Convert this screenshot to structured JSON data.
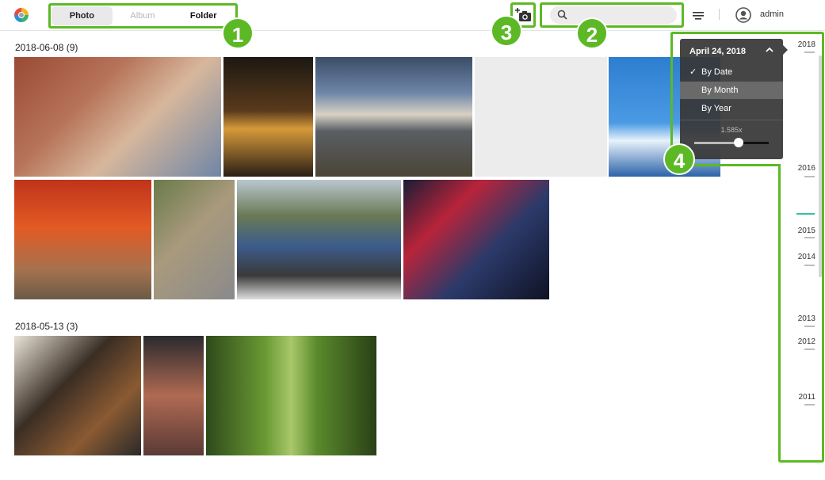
{
  "header": {
    "tabs": [
      {
        "label": "Photo",
        "state": "active"
      },
      {
        "label": "Album",
        "state": "disabled"
      },
      {
        "label": "Folder",
        "state": "normal"
      }
    ],
    "search": {
      "placeholder": "",
      "value": ""
    },
    "user": "admin",
    "icons": {
      "logo": "app-logo-icon",
      "upload": "camera-add-icon",
      "search": "search-icon",
      "filter": "filter-icon",
      "avatar": "user-avatar-icon"
    }
  },
  "sections": [
    {
      "title": "2018-06-08 (9)",
      "photos": [
        {
          "name": "two-women-laughing",
          "color": "#b58a6a"
        },
        {
          "name": "night-alley-signs",
          "color": "#3a2a1e"
        },
        {
          "name": "mount-fuji-clouds",
          "color": "#6f8198"
        },
        {
          "name": "placeholder-loading",
          "color": "#ececec"
        },
        {
          "name": "fuji-cherry-blossom",
          "color": "#3d8fd6"
        },
        {
          "name": "torii-gates",
          "color": "#d9521f"
        },
        {
          "name": "woman-curly-hair",
          "color": "#8c8a70"
        },
        {
          "name": "blue-car-street",
          "color": "#4e5a66"
        },
        {
          "name": "neon-street-night",
          "color": "#2a2f4a"
        }
      ]
    },
    {
      "title": "2018-05-13 (3)",
      "photos": [
        {
          "name": "food-table-teapot",
          "color": "#5a4a3a"
        },
        {
          "name": "woman-beanie",
          "color": "#7a4a3a"
        },
        {
          "name": "bamboo-forest",
          "color": "#4f7a2a"
        }
      ]
    }
  ],
  "timeline": {
    "years": [
      "2018",
      "2016",
      "2015",
      "2014",
      "2013",
      "2012",
      "2011"
    ]
  },
  "popover": {
    "date": "April 24, 2018",
    "options": [
      {
        "label": "By Date",
        "checked": true,
        "highlighted": false
      },
      {
        "label": "By Month",
        "checked": false,
        "highlighted": true
      },
      {
        "label": "By Year",
        "checked": false,
        "highlighted": false
      }
    ],
    "zoom_label": "1.585x",
    "zoom_fraction": 0.6
  },
  "callouts": [
    "1",
    "2",
    "3",
    "4"
  ],
  "colors": {
    "callout": "#5cb925",
    "marker": "#2ec4a6"
  }
}
